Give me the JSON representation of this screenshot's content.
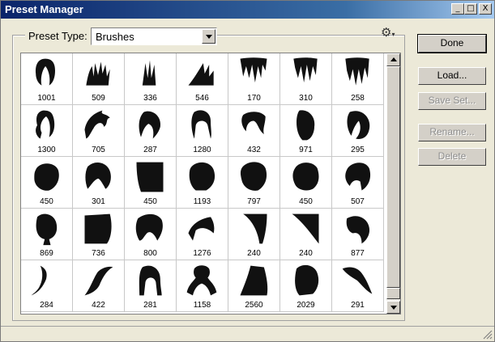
{
  "window": {
    "title": "Preset Manager",
    "controls": {
      "minimize": "_",
      "maximize": "□",
      "close": "X"
    }
  },
  "preset_type": {
    "label": "Preset Type:",
    "value": "Brushes"
  },
  "menu_icon": "gear-icon",
  "buttons": {
    "done": "Done",
    "load": "Load...",
    "save_set": "Save Set...",
    "rename": "Rename...",
    "delete": "Delete"
  },
  "brushes": [
    {
      "size": "1001"
    },
    {
      "size": "509"
    },
    {
      "size": "336"
    },
    {
      "size": "546"
    },
    {
      "size": "170"
    },
    {
      "size": "310"
    },
    {
      "size": "258"
    },
    {
      "size": "1300"
    },
    {
      "size": "705"
    },
    {
      "size": "287"
    },
    {
      "size": "1280"
    },
    {
      "size": "432"
    },
    {
      "size": "971"
    },
    {
      "size": "295"
    },
    {
      "size": "450"
    },
    {
      "size": "301"
    },
    {
      "size": "450"
    },
    {
      "size": "1193"
    },
    {
      "size": "797"
    },
    {
      "size": "450"
    },
    {
      "size": "507"
    },
    {
      "size": "869"
    },
    {
      "size": "736"
    },
    {
      "size": "800"
    },
    {
      "size": "1276"
    },
    {
      "size": "240"
    },
    {
      "size": "240"
    },
    {
      "size": "877"
    },
    {
      "size": "284"
    },
    {
      "size": "422"
    },
    {
      "size": "281"
    },
    {
      "size": "1158"
    },
    {
      "size": "2560"
    },
    {
      "size": "2029"
    },
    {
      "size": "291"
    }
  ]
}
